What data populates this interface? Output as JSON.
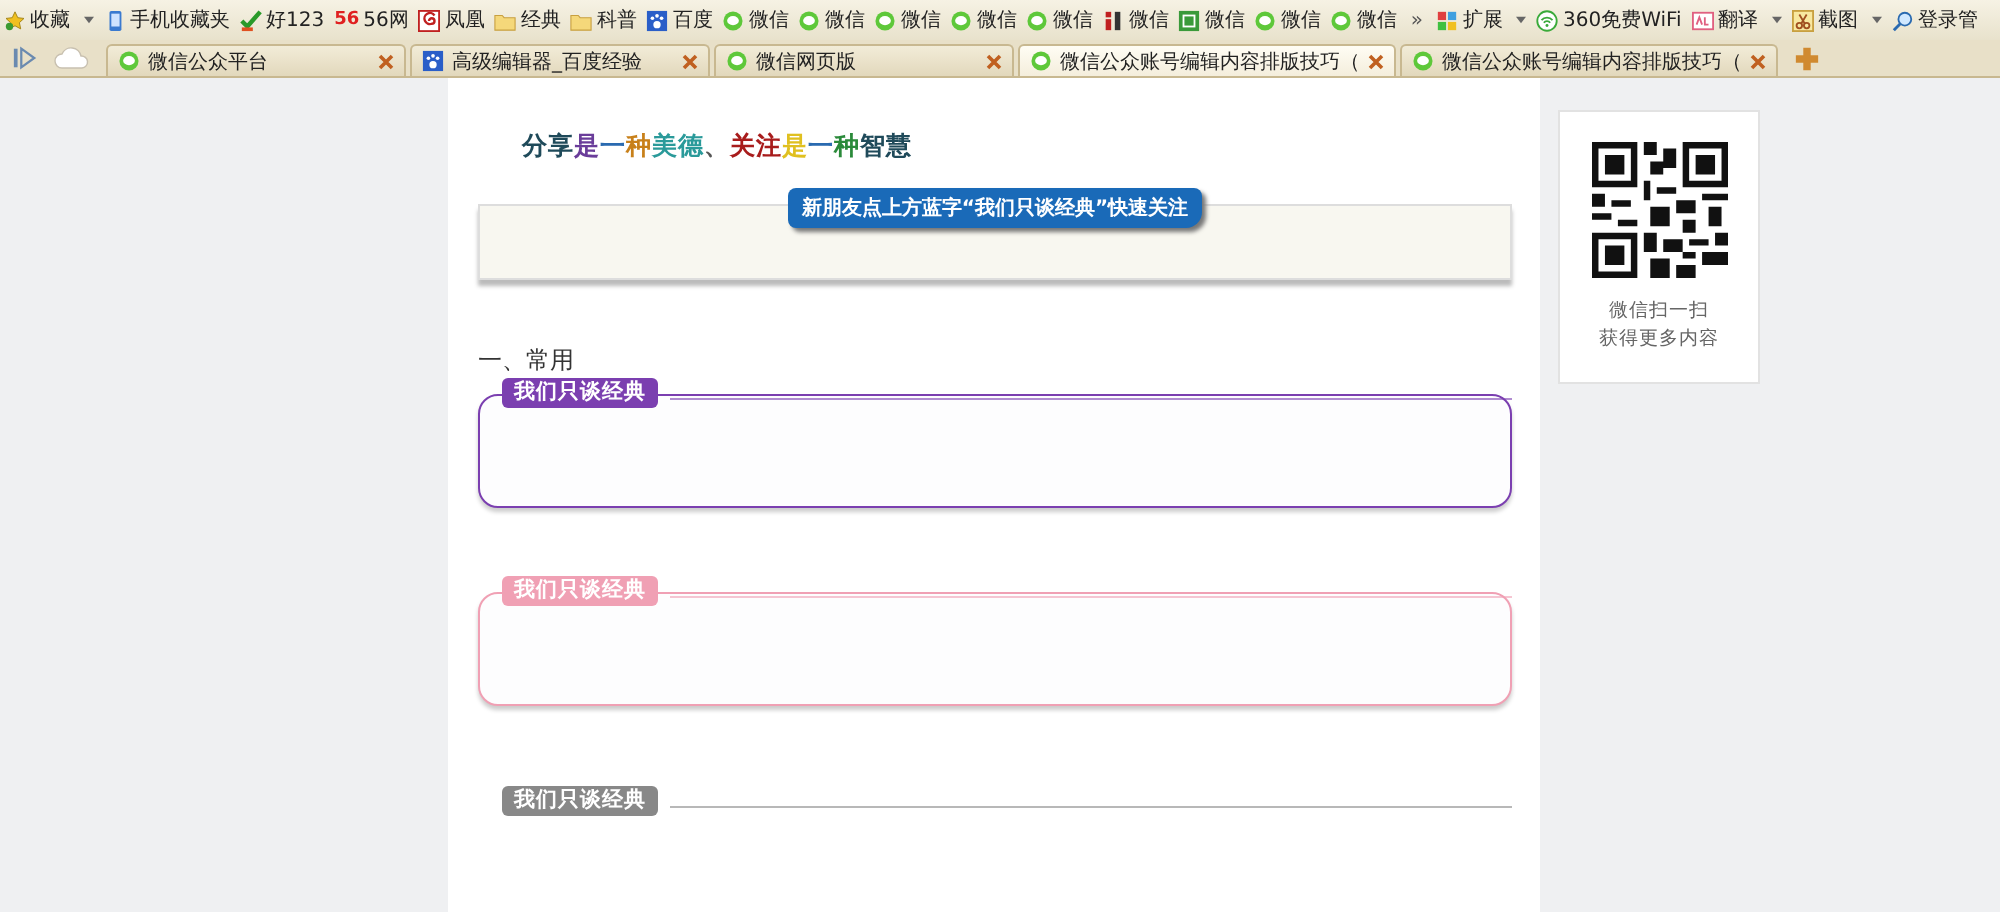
{
  "bookmarks": [
    {
      "kind": "star",
      "label": "收藏",
      "dropdown": true
    },
    {
      "kind": "phone",
      "label": "手机收藏夹",
      "dropdown": false
    },
    {
      "kind": "check",
      "label": "好123",
      "dropdown": false
    },
    {
      "kind": "logo",
      "icon_text": "56",
      "label": "56网",
      "dropdown": false
    },
    {
      "kind": "spiral",
      "label": "凤凰",
      "dropdown": false
    },
    {
      "kind": "folder",
      "label": "经典",
      "dropdown": false
    },
    {
      "kind": "folder",
      "label": "科普",
      "dropdown": false
    },
    {
      "kind": "paw",
      "label": "百度",
      "dropdown": false
    },
    {
      "kind": "chat",
      "label": "微信",
      "dropdown": false
    },
    {
      "kind": "chat",
      "label": "微信",
      "dropdown": false
    },
    {
      "kind": "chat",
      "label": "微信",
      "dropdown": false
    },
    {
      "kind": "chat",
      "label": "微信",
      "dropdown": false
    },
    {
      "kind": "chat",
      "label": "微信",
      "dropdown": false
    },
    {
      "kind": "bars",
      "label": "微信",
      "dropdown": false
    },
    {
      "kind": "square",
      "label": "微信",
      "dropdown": false
    },
    {
      "kind": "chat",
      "label": "微信",
      "dropdown": false
    },
    {
      "kind": "chat",
      "label": "微信",
      "dropdown": false
    }
  ],
  "more": "»",
  "tools": [
    {
      "kind": "puzzle",
      "label": "扩展",
      "dropdown": true
    },
    {
      "kind": "wifi",
      "label": "360免费WiFi",
      "dropdown": false
    },
    {
      "kind": "translate",
      "label": "翻译",
      "dropdown": true
    },
    {
      "kind": "scissors",
      "label": "截图",
      "dropdown": true
    },
    {
      "kind": "search",
      "label": "登录管",
      "dropdown": false
    }
  ],
  "tabs": [
    {
      "kind": "chat",
      "title": "微信公众平台",
      "selected": false
    },
    {
      "kind": "paw",
      "title": "高级编辑器_百度经验",
      "selected": false
    },
    {
      "kind": "chat",
      "title": "微信网页版",
      "selected": false
    },
    {
      "kind": "chat",
      "title": "微信公众账号编辑内容排版技巧（",
      "selected": true
    },
    {
      "kind": "chat",
      "title": "微信公众账号编辑内容排版技巧（",
      "selected": false
    }
  ],
  "slogan": [
    {
      "text": "分享",
      "color": "#1f4a5a"
    },
    {
      "text": "是",
      "color": "#6a3d9a"
    },
    {
      "text": "一",
      "color": "#2a6ab0"
    },
    {
      "text": "种",
      "color": "#c8801a"
    },
    {
      "text": "美德",
      "color": "#2a9a9a"
    },
    {
      "text": "、",
      "color": "#555555"
    },
    {
      "text": "关注",
      "color": "#a81c1c"
    },
    {
      "text": "是",
      "color": "#e0c020"
    },
    {
      "text": "一",
      "color": "#2a6ab0"
    },
    {
      "text": "种",
      "color": "#2a8a3a"
    },
    {
      "text": "智慧",
      "color": "#1f4a5a"
    }
  ],
  "banner": "新朋友点上方蓝字“我们只谈经典”快速关注",
  "section_heading": "一、常用",
  "cards": [
    {
      "tag": "我们只谈经典",
      "color": "#7b3fb0"
    },
    {
      "tag": "我们只谈经典",
      "color": "#f0a0b4"
    },
    {
      "tag": "我们只谈经典",
      "color": "#888888"
    }
  ],
  "qr": {
    "lines": [
      "微信扫一扫",
      "获得更多内容"
    ]
  }
}
